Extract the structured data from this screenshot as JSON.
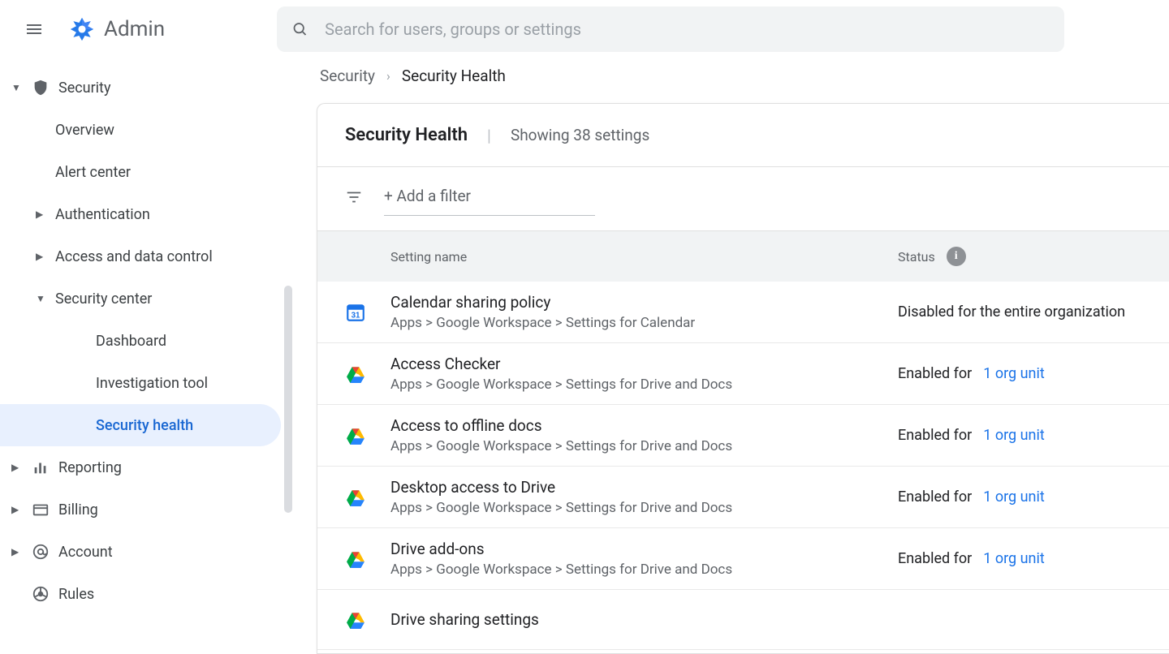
{
  "brand": {
    "name": "Admin"
  },
  "search": {
    "placeholder": "Search for users, groups or settings"
  },
  "sidebar": {
    "security": {
      "label": "Security",
      "overview": "Overview",
      "alert_center": "Alert center",
      "authentication": "Authentication",
      "access_data": "Access and data control",
      "security_center": {
        "label": "Security center",
        "dashboard": "Dashboard",
        "investigation": "Investigation tool",
        "security_health": "Security health"
      }
    },
    "reporting": "Reporting",
    "billing": "Billing",
    "account": "Account",
    "rules": "Rules"
  },
  "breadcrumb": {
    "root": "Security",
    "leaf": "Security Health"
  },
  "panel": {
    "title": "Security Health",
    "subtitle": "Showing 38 settings",
    "add_filter": "+ Add a filter"
  },
  "table": {
    "header_name": "Setting name",
    "header_status": "Status",
    "rows": [
      {
        "icon": "calendar",
        "title": "Calendar sharing policy",
        "path": "Apps > Google Workspace > Settings for Calendar",
        "status_prefix": "Disabled for the entire organization",
        "status_link": ""
      },
      {
        "icon": "drive",
        "title": "Access Checker",
        "path": "Apps > Google Workspace > Settings for Drive and Docs",
        "status_prefix": "Enabled for ",
        "status_link": "1 org unit"
      },
      {
        "icon": "drive",
        "title": "Access to offline docs",
        "path": "Apps > Google Workspace > Settings for Drive and Docs",
        "status_prefix": "Enabled for ",
        "status_link": "1 org unit"
      },
      {
        "icon": "drive",
        "title": "Desktop access to Drive",
        "path": "Apps > Google Workspace > Settings for Drive and Docs",
        "status_prefix": "Enabled for ",
        "status_link": "1 org unit"
      },
      {
        "icon": "drive",
        "title": "Drive add-ons",
        "path": "Apps > Google Workspace > Settings for Drive and Docs",
        "status_prefix": "Enabled for ",
        "status_link": "1 org unit"
      },
      {
        "icon": "drive",
        "title": "Drive sharing settings",
        "path": "",
        "status_prefix": "",
        "status_link": ""
      }
    ]
  }
}
